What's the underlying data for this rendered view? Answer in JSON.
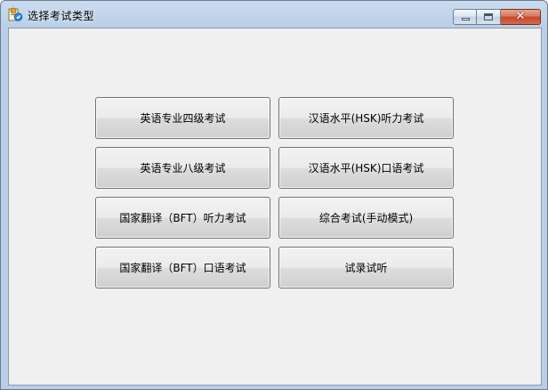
{
  "window": {
    "title": "选择考试类型",
    "icons": {
      "app": "exam-app-icon",
      "minimize": "minimize-icon",
      "maximize": "maximize-icon",
      "close": "close-icon"
    },
    "close_glyph": "✕"
  },
  "buttons": [
    {
      "label": "英语专业四级考试"
    },
    {
      "label": "汉语水平(HSK)听力考试"
    },
    {
      "label": "英语专业八级考试"
    },
    {
      "label": "汉语水平(HSK)口语考试"
    },
    {
      "label": "国家翻译（BFT）听力考试"
    },
    {
      "label": "综合考试(手动模式)"
    },
    {
      "label": "国家翻译（BFT）口语考试"
    },
    {
      "label": "试录试听"
    }
  ]
}
